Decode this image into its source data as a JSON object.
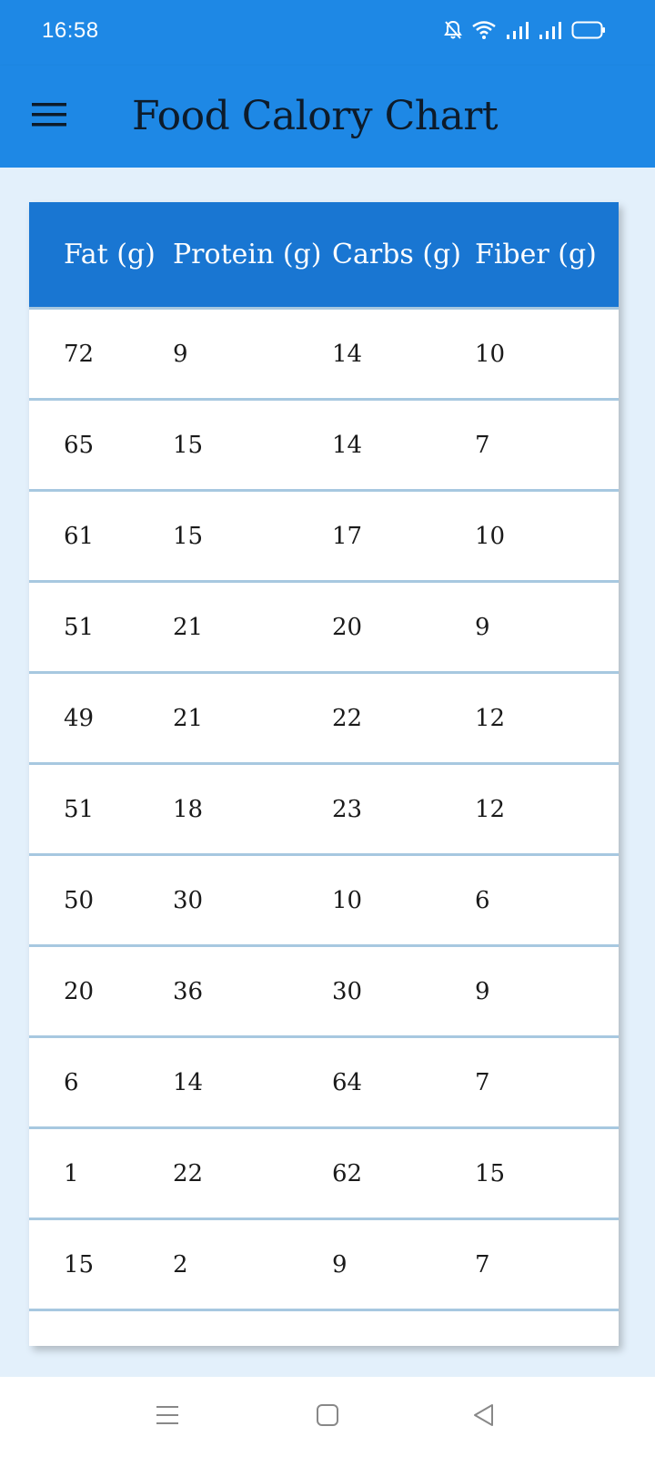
{
  "status_bar": {
    "time": "16:58"
  },
  "app_bar": {
    "title": "Food Calory Chart"
  },
  "table": {
    "columns": [
      "Fat (g)",
      "Protein (g)",
      "Carbs (g)",
      "Fiber (g)"
    ],
    "rows": [
      [
        "72",
        "9",
        "14",
        "10"
      ],
      [
        "65",
        "15",
        "14",
        "7"
      ],
      [
        "61",
        "15",
        "17",
        "10"
      ],
      [
        "51",
        "21",
        "20",
        "9"
      ],
      [
        "49",
        "21",
        "22",
        "12"
      ],
      [
        "51",
        "18",
        "23",
        "12"
      ],
      [
        "50",
        "30",
        "10",
        "6"
      ],
      [
        "20",
        "36",
        "30",
        "9"
      ],
      [
        "6",
        "14",
        "64",
        "7"
      ],
      [
        "1",
        "22",
        "62",
        "15"
      ],
      [
        "15",
        "2",
        "9",
        "7"
      ],
      [
        "",
        "",
        "",
        ""
      ]
    ]
  },
  "colors": {
    "primary": "#1e88e5",
    "header": "#1976d2",
    "background": "#e3f0fb",
    "divider": "#a7c8e0"
  },
  "icons": {
    "menu": "hamburger-icon",
    "nav_menu": "nav-menu-icon",
    "nav_home": "nav-home-icon",
    "nav_back": "nav-back-icon"
  }
}
